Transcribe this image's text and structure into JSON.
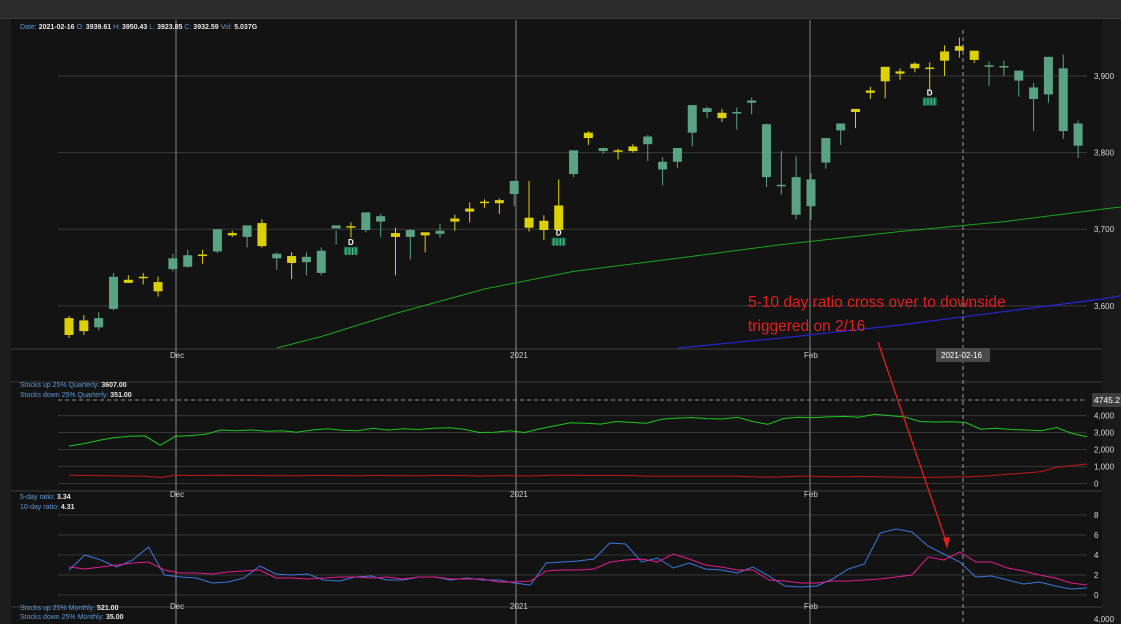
{
  "header": {
    "date_label": "Date:",
    "date": "2021-02-16",
    "o_label": "O:",
    "open": "3939.61",
    "h_label": "H:",
    "high": "3950.43",
    "l_label": "L:",
    "low": "3923.85",
    "c_label": "C:",
    "close": "3932.59",
    "vol_label": "Vol:",
    "volume": "5.037G"
  },
  "annotation": {
    "line1": "5-10 day ratio cross over to downside",
    "line2": "triggered on 2/16",
    "color": "#e0201c"
  },
  "crosshair_date": "2021-02-16",
  "panels": {
    "quarterly": {
      "up_label": "Stocks up 25% Quarterly:",
      "up_value": "3607.00",
      "down_label": "Stocks down 25% Quarterly:",
      "down_value": "351.00",
      "cursor_value": "4745.2"
    },
    "ratio": {
      "r5_label": "5-day ratio:",
      "r5_value": "3.34",
      "r10_label": "10-day ratio:",
      "r10_value": "4.31"
    },
    "monthly": {
      "up_label": "Stocks up 25% Monthly:",
      "up_value": "521.00",
      "down_label": "Stocks down 25% Monthly:",
      "down_value": "35.00",
      "tick": "4,000"
    }
  },
  "chart_data": [
    {
      "type": "candlestick",
      "title": "",
      "x_tick_labels": [
        "Dec",
        "2021",
        "Feb"
      ],
      "y_ticks": [
        3600,
        3700,
        3800,
        3900
      ],
      "y_tick_labels": [
        "3,600",
        "3,700",
        "3,800",
        "3,900"
      ],
      "ylim": [
        3545,
        3960
      ],
      "grid": true,
      "colors": {
        "up": "#5aa382",
        "down": "#dcd000",
        "ma_fast": "#1aa51a",
        "ma_slow": "#2424c8"
      },
      "candles": [
        [
          3584,
          3587,
          3558,
          3562,
          0
        ],
        [
          3581,
          3588,
          3562,
          3567,
          0
        ],
        [
          3572,
          3592,
          3568,
          3584,
          1
        ],
        [
          3596,
          3643,
          3594,
          3638,
          1
        ],
        [
          3634,
          3640,
          3630,
          3630,
          0
        ],
        [
          3638,
          3643,
          3628,
          3637,
          0
        ],
        [
          3631,
          3638,
          3612,
          3619,
          0
        ],
        [
          3648,
          3668,
          3645,
          3662,
          1
        ],
        [
          3651,
          3673,
          3650,
          3666,
          1
        ],
        [
          3665,
          3673,
          3655,
          3667,
          0
        ],
        [
          3671,
          3697,
          3669,
          3700,
          1
        ],
        [
          3695,
          3698,
          3690,
          3692,
          0
        ],
        [
          3690,
          3701,
          3676,
          3705,
          1
        ],
        [
          3708,
          3713,
          3676,
          3678,
          0
        ],
        [
          3662,
          3670,
          3647,
          3668,
          1
        ],
        [
          3665,
          3670,
          3635,
          3656,
          0
        ],
        [
          3657,
          3670,
          3640,
          3664,
          1
        ],
        [
          3643,
          3676,
          3640,
          3672,
          1
        ],
        [
          3701,
          3698,
          3680,
          3705,
          1
        ],
        [
          3704,
          3709,
          3689,
          3703,
          0
        ],
        [
          3699,
          3712,
          3696,
          3722,
          1
        ],
        [
          3710,
          3720,
          3690,
          3717,
          1
        ],
        [
          3695,
          3702,
          3640,
          3690,
          0
        ],
        [
          3690,
          3700,
          3660,
          3699,
          1
        ],
        [
          3692,
          3695,
          3670,
          3696,
          0
        ],
        [
          3694,
          3707,
          3689,
          3698,
          1
        ],
        [
          3714,
          3719,
          3698,
          3710,
          0
        ],
        [
          3723,
          3735,
          3709,
          3727,
          0
        ],
        [
          3736,
          3739,
          3728,
          3736,
          0
        ],
        [
          3734,
          3740,
          3720,
          3738,
          0
        ],
        [
          3746,
          3751,
          3730,
          3763,
          1
        ],
        [
          3702,
          3763,
          3697,
          3715,
          0
        ],
        [
          3699,
          3718,
          3686,
          3711,
          0
        ],
        [
          3731,
          3765,
          3720,
          3699,
          0
        ],
        [
          3772,
          3790,
          3768,
          3803,
          1
        ],
        [
          3826,
          3828,
          3810,
          3819,
          0
        ],
        [
          3806,
          3804,
          3798,
          3802,
          1
        ],
        [
          3803,
          3805,
          3791,
          3801,
          0
        ],
        [
          3808,
          3811,
          3800,
          3802,
          0
        ],
        [
          3811,
          3823,
          3789,
          3821,
          1
        ],
        [
          3788,
          3794,
          3757,
          3778,
          1
        ],
        [
          3788,
          3804,
          3780,
          3806,
          1
        ],
        [
          3826,
          3858,
          3808,
          3862,
          1
        ],
        [
          3853,
          3860,
          3845,
          3858,
          1
        ],
        [
          3852,
          3857,
          3840,
          3845,
          0
        ],
        [
          3852,
          3859,
          3830,
          3853,
          1
        ],
        [
          3865,
          3872,
          3850,
          3868,
          1
        ],
        [
          3837,
          3838,
          3755,
          3768,
          1
        ],
        [
          3756,
          3802,
          3745,
          3758,
          1
        ],
        [
          3768,
          3795,
          3713,
          3719,
          1
        ],
        [
          3730,
          3773,
          3712,
          3765,
          1
        ],
        [
          3787,
          3812,
          3779,
          3819,
          1
        ],
        [
          3829,
          3832,
          3810,
          3838,
          1
        ],
        [
          3853,
          3855,
          3832,
          3857,
          0
        ],
        [
          3878,
          3886,
          3870,
          3881,
          0
        ],
        [
          3893,
          3911,
          3871,
          3912,
          0
        ],
        [
          3903,
          3910,
          3895,
          3906,
          0
        ],
        [
          3910,
          3918,
          3905,
          3916,
          0
        ],
        [
          3910,
          3918,
          3880,
          3911,
          0
        ],
        [
          3920,
          3940,
          3900,
          3932,
          0
        ],
        [
          3939,
          3950,
          3924,
          3933,
          0
        ],
        [
          3933,
          3931,
          3917,
          3921,
          0
        ],
        [
          3914,
          3919,
          3887,
          3912,
          1
        ],
        [
          3913,
          3920,
          3900,
          3912,
          1
        ],
        [
          3894,
          3906,
          3873,
          3907,
          1
        ],
        [
          3870,
          3891,
          3828,
          3885,
          1
        ],
        [
          3876,
          3925,
          3865,
          3925,
          1
        ],
        [
          3910,
          3928,
          3818,
          3828,
          1
        ],
        [
          3809,
          3842,
          3793,
          3838,
          1
        ]
      ],
      "ma_fast_points": [
        [
          14,
          3545
        ],
        [
          17,
          3560
        ],
        [
          22,
          3590
        ],
        [
          28,
          3622
        ],
        [
          34,
          3645
        ],
        [
          41,
          3662
        ],
        [
          48,
          3680
        ],
        [
          56,
          3697
        ],
        [
          63,
          3710
        ],
        [
          70,
          3727
        ],
        [
          76,
          3740
        ],
        [
          80,
          3748
        ],
        [
          85,
          3758
        ],
        [
          91,
          3778
        ],
        [
          97,
          3795
        ],
        [
          103,
          3808
        ],
        [
          109,
          3820
        ],
        [
          114,
          3838
        ],
        [
          119,
          3847
        ],
        [
          125,
          3862
        ],
        [
          131,
          3875
        ],
        [
          140,
          3880
        ],
        [
          147,
          3877
        ]
      ],
      "ma_slow_points": [
        [
          41,
          3545
        ],
        [
          48,
          3558
        ],
        [
          56,
          3575
        ],
        [
          62,
          3590
        ],
        [
          70,
          3610
        ],
        [
          78,
          3640
        ],
        [
          86,
          3667
        ],
        [
          94,
          3692
        ],
        [
          101,
          3710
        ],
        [
          108,
          3723
        ],
        [
          115,
          3738
        ],
        [
          122,
          3752
        ],
        [
          129,
          3769
        ],
        [
          134,
          3780
        ],
        [
          140,
          3793
        ],
        [
          147,
          3808
        ]
      ],
      "marker_text": "D",
      "markers": [
        {
          "candle": 19,
          "price": 3677
        },
        {
          "candle": 33,
          "price": 3689
        },
        {
          "candle": 58,
          "price": 3872
        }
      ]
    },
    {
      "type": "line",
      "title": "",
      "y_tick_labels": [
        "0",
        "1,000",
        "2,000",
        "3,000",
        "4,000"
      ],
      "ylim": [
        -150,
        4800
      ],
      "grid": true,
      "series": [
        {
          "name": "Stocks up 25% Quarterly",
          "color": "#1ec81e",
          "values": [
            2200,
            2350,
            2550,
            2700,
            2780,
            2800,
            2250,
            2780,
            2820,
            2900,
            3150,
            3100,
            3150,
            3080,
            3100,
            3020,
            3150,
            3220,
            3130,
            3100,
            3250,
            3150,
            3220,
            3180,
            3250,
            3280,
            3200,
            3000,
            3020,
            3100,
            3000,
            3220,
            3400,
            3580,
            3550,
            3500,
            3650,
            3600,
            3550,
            3780,
            3850,
            3880,
            3820,
            3800,
            3900,
            3650,
            3480,
            3820,
            3900,
            3880,
            3920,
            3950,
            3900,
            4080,
            4000,
            3920,
            3650,
            3620,
            3640,
            3600,
            3200,
            3250,
            3180,
            3150,
            3100,
            3300,
            2950,
            2750
          ]
        },
        {
          "name": "Stocks down 25% Quarterly",
          "color": "#c01818",
          "values": [
            480,
            470,
            460,
            450,
            430,
            420,
            350,
            480,
            470,
            470,
            480,
            470,
            470,
            460,
            460,
            450,
            470,
            470,
            460,
            450,
            470,
            460,
            460,
            450,
            470,
            470,
            460,
            440,
            450,
            460,
            440,
            460,
            480,
            480,
            470,
            470,
            470,
            460,
            430,
            420,
            430,
            420,
            420,
            420,
            420,
            390,
            370,
            400,
            420,
            420,
            400,
            400,
            410,
            400,
            380,
            360,
            350,
            370,
            380,
            400,
            420,
            480,
            560,
            620,
            700,
            950,
            1050,
            1150
          ]
        }
      ]
    },
    {
      "type": "line",
      "title": "",
      "x_tick_labels": [
        "Dec",
        "2021",
        "Feb"
      ],
      "y_tick_labels": [
        "0",
        "2",
        "4",
        "6",
        "8"
      ],
      "ylim": [
        -0.5,
        9
      ],
      "grid": true,
      "series": [
        {
          "name": "5-day ratio",
          "color": "#3a78d8",
          "values": [
            2.5,
            4.0,
            3.5,
            2.8,
            3.5,
            4.8,
            2.0,
            1.8,
            1.7,
            1.2,
            1.3,
            1.7,
            2.9,
            2.1,
            2.0,
            2.1,
            1.5,
            1.4,
            1.8,
            1.9,
            1.5,
            1.5,
            1.8,
            1.8,
            1.5,
            1.7,
            1.5,
            1.5,
            1.2,
            1.0,
            3.2,
            3.3,
            3.4,
            3.6,
            5.2,
            5.1,
            3.3,
            3.7,
            2.7,
            3.2,
            2.6,
            2.5,
            2.2,
            2.8,
            1.9,
            0.9,
            0.8,
            0.9,
            1.6,
            2.6,
            3.1,
            6.2,
            6.6,
            6.3,
            4.9,
            4.1,
            3.3,
            1.8,
            1.9,
            1.5,
            1.1,
            1.3,
            0.9,
            0.6,
            0.7
          ]
        },
        {
          "name": "10-day ratio",
          "color": "#e01c8e",
          "values": [
            2.8,
            2.6,
            2.8,
            3.0,
            3.2,
            3.3,
            2.5,
            2.2,
            2.2,
            2.1,
            2.3,
            2.4,
            2.5,
            1.7,
            1.7,
            1.6,
            1.7,
            1.8,
            1.8,
            1.7,
            1.8,
            1.6,
            1.8,
            1.8,
            1.6,
            1.6,
            1.6,
            1.3,
            1.3,
            1.4,
            2.4,
            2.5,
            2.5,
            2.6,
            3.3,
            3.5,
            3.6,
            3.3,
            4.1,
            3.6,
            3.0,
            2.8,
            2.5,
            2.5,
            1.5,
            1.4,
            1.2,
            1.2,
            1.4,
            1.4,
            1.5,
            1.6,
            1.8,
            2.0,
            3.8,
            3.5,
            4.3,
            3.3,
            3.3,
            2.7,
            2.4,
            2.0,
            1.7,
            1.2,
            1.0
          ]
        }
      ]
    }
  ]
}
